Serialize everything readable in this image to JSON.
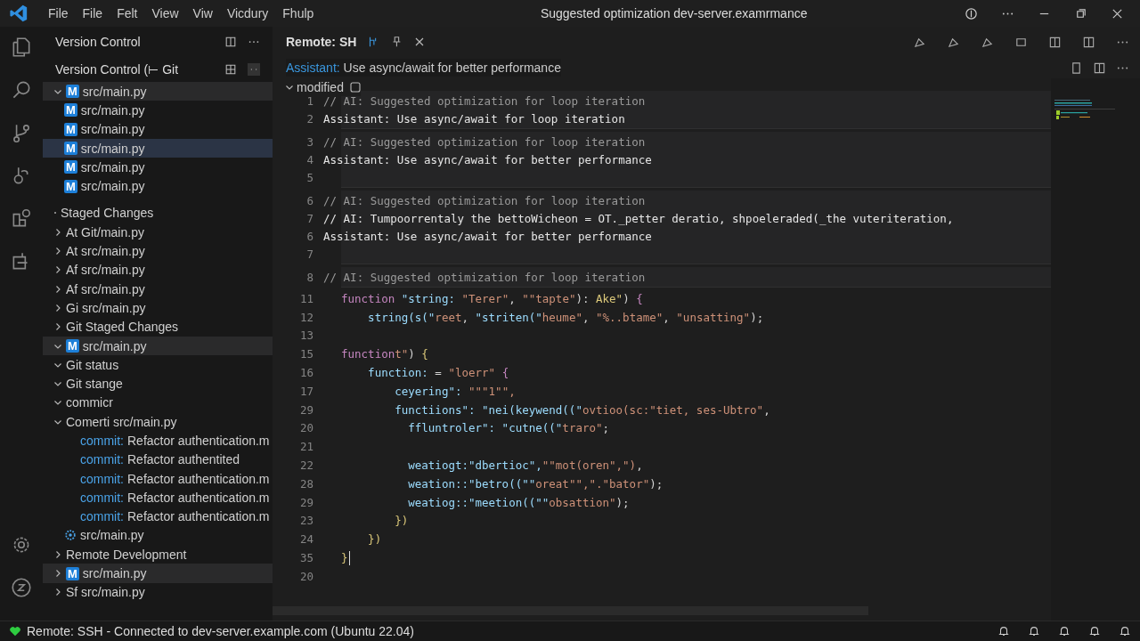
{
  "title_bar": {
    "menus": [
      "File",
      "File",
      "Felt",
      "View",
      "Viw",
      "Vicdury",
      "Fhulp"
    ],
    "title": "Suggested  optimization dev-server.examrmance"
  },
  "sidebar": {
    "title": "Version Control",
    "subtitle": "Version Control (⊢ Git",
    "items": [
      {
        "kind": "file",
        "badge": "M",
        "label": "src/main.py",
        "expanded": true,
        "selected": false,
        "highlighted": true,
        "children": [
          {
            "kind": "file",
            "badge": "M",
            "label": "src/main.py",
            "selected": false,
            "highlighted": false
          },
          {
            "kind": "file",
            "badge": "M",
            "label": "src/main.py",
            "selected": false,
            "highlighted": false
          },
          {
            "kind": "file",
            "badge": "M",
            "label": "src/main.py",
            "selected": true,
            "highlighted": false
          },
          {
            "kind": "file",
            "badge": "M",
            "label": "src/main.py",
            "selected": false,
            "highlighted": false
          },
          {
            "kind": "file",
            "badge": "M",
            "label": "src/main.py",
            "selected": false,
            "highlighted": false
          }
        ]
      },
      {
        "kind": "section",
        "label": "Staged Changes",
        "selected": false,
        "highlighted": false
      },
      {
        "kind": "folder",
        "label": "At Git/main.py",
        "expanded": false,
        "selected": false,
        "highlighted": false
      },
      {
        "kind": "folder",
        "label": "At src/main.py",
        "expanded": false,
        "selected": false,
        "highlighted": false
      },
      {
        "kind": "folder",
        "label": "Af src/main.py",
        "expanded": false,
        "selected": false,
        "highlighted": false
      },
      {
        "kind": "folder",
        "label": "Af src/main.py",
        "expanded": false,
        "selected": false,
        "highlighted": false
      },
      {
        "kind": "folder",
        "label": "Gi src/main.py",
        "expanded": false,
        "selected": false,
        "highlighted": false
      },
      {
        "kind": "folder",
        "label": "Git Staged Changes",
        "expanded": false,
        "selected": false,
        "highlighted": false
      },
      {
        "kind": "file",
        "badge": "M",
        "label": "src/main.py",
        "expanded": true,
        "selected": false,
        "highlighted": true
      },
      {
        "kind": "folder",
        "label": "Git status",
        "expanded": true,
        "selected": false,
        "highlighted": false
      },
      {
        "kind": "folder",
        "label": "Git stange",
        "expanded": true,
        "selected": false,
        "highlighted": false
      },
      {
        "kind": "folder",
        "label": "commicr",
        "expanded": true,
        "selected": false,
        "highlighted": false
      },
      {
        "kind": "folder",
        "label": "Comerti src/main.py",
        "expanded": true,
        "selected": false,
        "highlighted": false,
        "children": [
          {
            "kind": "commit",
            "prefix": "commit:",
            "label": "Refactor authentication.m",
            "selected": false,
            "highlighted": false
          },
          {
            "kind": "commit",
            "prefix": "commit:",
            "label": "Refactor authentited",
            "selected": false,
            "highlighted": false
          },
          {
            "kind": "commit",
            "prefix": "commit:",
            "label": "Refactor authentication.m",
            "selected": false,
            "highlighted": false
          },
          {
            "kind": "commit",
            "prefix": "commit:",
            "label": "Refactor authentication.m",
            "selected": false,
            "highlighted": false
          },
          {
            "kind": "commit",
            "prefix": "commit:",
            "label": "Refactor authentication.m",
            "selected": false,
            "highlighted": false
          },
          {
            "kind": "gear-file",
            "label": "src/main.py",
            "selected": false,
            "highlighted": false
          }
        ]
      },
      {
        "kind": "folder",
        "label": "Remote Development",
        "expanded": false,
        "selected": false,
        "highlighted": false
      },
      {
        "kind": "file",
        "badge": "M",
        "label": "src/main.py",
        "expanded": false,
        "selected": false,
        "highlighted": true
      },
      {
        "kind": "folder",
        "label": "Sf src/main.py",
        "expanded": false,
        "selected": false,
        "highlighted": false
      }
    ]
  },
  "editor": {
    "tab": {
      "label": "Remote: SH"
    },
    "assistant": {
      "label": "Assistant:",
      "text": "Use async/await for better performance"
    },
    "section": {
      "label": "modified"
    },
    "suggestions": [
      {
        "lines": [
          {
            "number": "1",
            "kind": "comment",
            "text": "// AI: Suggested optimization for loop iteration"
          },
          {
            "number": "2",
            "kind": "assistant",
            "text": "Assistant: Use async/await for loop iteration"
          }
        ]
      },
      {
        "lines": [
          {
            "number": "3",
            "kind": "comment",
            "text": "// AI: Suggested optimization for loop iteration"
          },
          {
            "number": "4",
            "kind": "assistant",
            "text": "Assistant: Use async/await for better performance"
          },
          {
            "number": "5"
          }
        ]
      },
      {
        "lines": [
          {
            "number": "6",
            "kind": "comment",
            "text": "// AI: Suggested optimization for loop iteration"
          },
          {
            "number": "7",
            "kind": "assistant",
            "text": "// AI: Tumpoorrentaly the bettoWicheon = OT._petter deratio, shpoeleraded(_the vuteriteration,"
          },
          {
            "number": "6",
            "kind": "assistant",
            "text": "Assistant: Use async/await for better performance"
          },
          {
            "number": "7"
          }
        ]
      },
      {
        "lines": [
          {
            "number": "8",
            "kind": "comment",
            "text": "// AI: Suggested optimization for loop iteration"
          }
        ]
      }
    ],
    "code": [
      {
        "number": "11",
        "cursor": false,
        "tokens": [
          {
            "kind": "keyword",
            "text": "function"
          },
          {
            "kind": "ident",
            "text": " \"string: "
          },
          {
            "kind": "string",
            "text": "\"Terer\""
          },
          {
            "kind": "plain",
            "text": ", "
          },
          {
            "kind": "string",
            "text": "\"\"tapte\""
          },
          {
            "kind": "plain",
            "text": "): "
          },
          {
            "kind": "yellow",
            "text": "Ake\""
          },
          {
            "kind": "plain",
            "text": ") "
          },
          {
            "kind": "keyword",
            "text": "{"
          }
        ]
      },
      {
        "number": "12",
        "cursor": false,
        "tokens": [
          {
            "kind": "ident",
            "text": "    string(s(\""
          },
          {
            "kind": "string",
            "text": "reet"
          },
          {
            "kind": "plain",
            "text": ", "
          },
          {
            "kind": "ident",
            "text": "\"striten(\""
          },
          {
            "kind": "string",
            "text": "heume\""
          },
          {
            "kind": "plain",
            "text": ", "
          },
          {
            "kind": "string",
            "text": "\"%..btame\""
          },
          {
            "kind": "plain",
            "text": ", "
          },
          {
            "kind": "string",
            "text": "\"unsatting\""
          },
          {
            "kind": "plain",
            "text": ");"
          }
        ]
      },
      {
        "number": "13",
        "cursor": false
      },
      {
        "number": "15",
        "cursor": false,
        "tokens": [
          {
            "kind": "keyword",
            "text": "function"
          },
          {
            "kind": "string",
            "text": "t\""
          },
          {
            "kind": "plain",
            "text": ") "
          },
          {
            "kind": "yellow",
            "text": "{"
          }
        ]
      },
      {
        "number": "16",
        "cursor": false,
        "tokens": [
          {
            "kind": "ident",
            "text": "    function: "
          },
          {
            "kind": "plain",
            "text": "= "
          },
          {
            "kind": "string",
            "text": "\"loerr\" "
          },
          {
            "kind": "keyword",
            "text": "{"
          }
        ]
      },
      {
        "number": "17",
        "cursor": false,
        "tokens": [
          {
            "kind": "ident",
            "text": "        ceyering\": "
          },
          {
            "kind": "string",
            "text": "\"\"\"1\"\","
          }
        ]
      },
      {
        "number": "29",
        "cursor": false,
        "tokens": [
          {
            "kind": "ident",
            "text": "        functiions\": \"nei(keywend((\""
          },
          {
            "kind": "string",
            "text": "ovtioo(sc:\"tiet, ses-Ubtro\""
          },
          {
            "kind": "plain",
            "text": ","
          }
        ]
      },
      {
        "number": "20",
        "cursor": false,
        "tokens": [
          {
            "kind": "ident",
            "text": "          ffluntroler\": \"cutne((\""
          },
          {
            "kind": "string",
            "text": "traro\""
          },
          {
            "kind": "plain",
            "text": ";"
          }
        ]
      },
      {
        "number": "21",
        "cursor": false
      },
      {
        "number": "22",
        "cursor": false,
        "tokens": [
          {
            "kind": "ident",
            "text": "          weatiogt:\"dbertioc\","
          },
          {
            "kind": "string",
            "text": "\"\"mot(oren\",\")"
          },
          {
            "kind": "plain",
            "text": ","
          }
        ]
      },
      {
        "number": "28",
        "cursor": false,
        "tokens": [
          {
            "kind": "ident",
            "text": "          weation::\"betro((\"\""
          },
          {
            "kind": "string",
            "text": "oreat\"\",\".\"bator\""
          },
          {
            "kind": "plain",
            "text": ");"
          }
        ]
      },
      {
        "number": "29",
        "cursor": false,
        "tokens": [
          {
            "kind": "ident",
            "text": "          weatiog::\"meetion((\"\""
          },
          {
            "kind": "string",
            "text": "obsattion\""
          },
          {
            "kind": "plain",
            "text": ");"
          }
        ]
      },
      {
        "number": "23",
        "cursor": false,
        "tokens": [
          {
            "kind": "yellow",
            "text": "        })"
          }
        ]
      },
      {
        "number": "24",
        "cursor": false,
        "tokens": [
          {
            "kind": "yellow",
            "text": "    })"
          }
        ]
      },
      {
        "number": "35",
        "cursor": true,
        "tokens": [
          {
            "kind": "yellow",
            "text": "}"
          }
        ]
      },
      {
        "number": "20",
        "cursor": false
      }
    ]
  },
  "status_bar": {
    "text": "Remote: SSH - Connected to dev-server.example.com (Ubuntu 22.04)"
  }
}
